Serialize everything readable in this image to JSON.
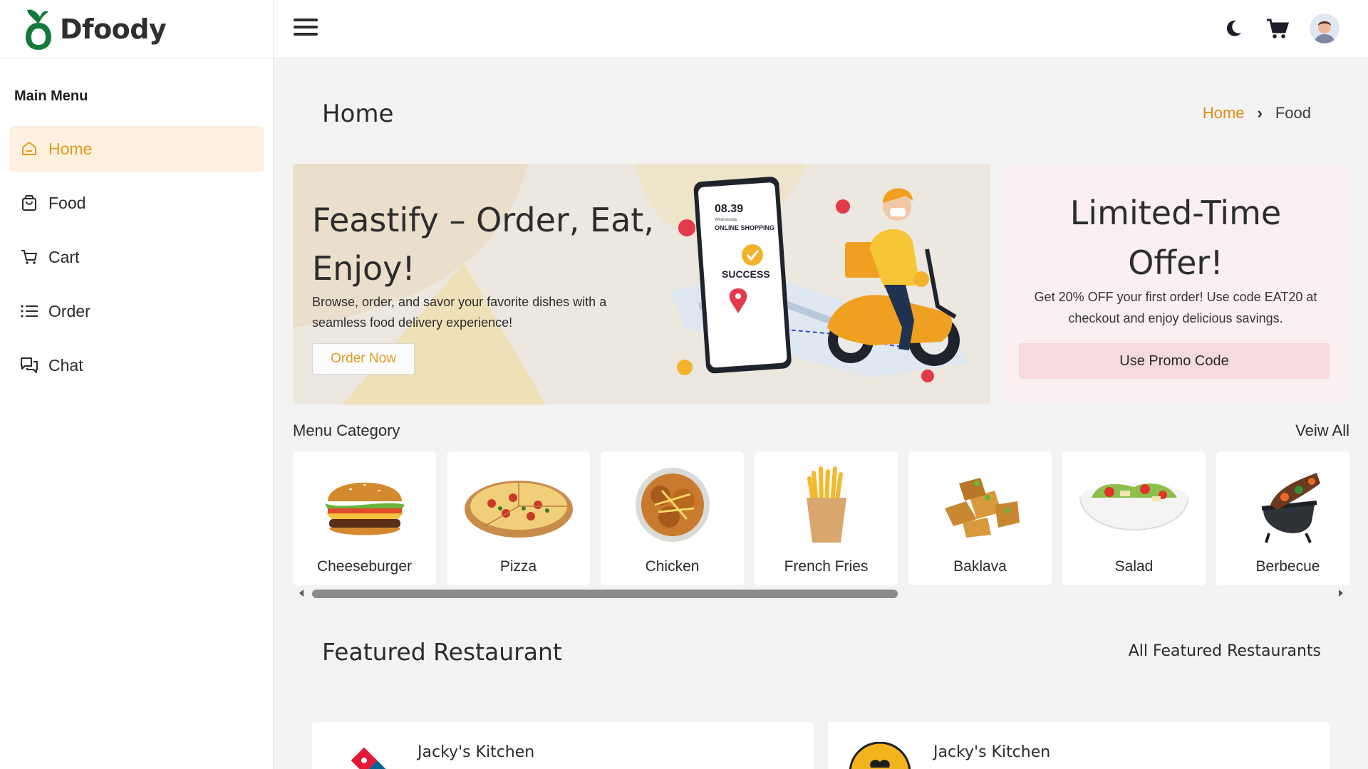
{
  "brand": {
    "name": "Dfoody",
    "accent": "#e29b21",
    "logo_color": "#137a3c"
  },
  "header": {
    "menu_icon": "hamburger-icon",
    "actions": [
      {
        "icon": "moon-icon"
      },
      {
        "icon": "cart-icon"
      },
      {
        "icon": "user-avatar"
      }
    ]
  },
  "sidebar": {
    "heading": "Main Menu",
    "items": [
      {
        "label": "Home",
        "icon": "home-icon",
        "active": true
      },
      {
        "label": "Food",
        "icon": "shopping-bag-icon",
        "active": false
      },
      {
        "label": "Cart",
        "icon": "cart-icon",
        "active": false
      },
      {
        "label": "Order",
        "icon": "list-icon",
        "active": false
      },
      {
        "label": "Chat",
        "icon": "chat-icon",
        "active": false
      }
    ]
  },
  "page": {
    "title": "Home",
    "breadcrumb": {
      "home": "Home",
      "separator": "›",
      "current": "Food"
    }
  },
  "hero": {
    "title": "Feastify – Order, Eat, Enjoy!",
    "text": "Browse, order, and savor your favorite dishes with a seamless food delivery experience!",
    "button": "Order Now",
    "phone_time": "08.39",
    "phone_day": "Wednesday",
    "phone_caption": "ONLINE SHOPPING",
    "phone_status": "SUCCESS"
  },
  "offer": {
    "title": "Limited-Time Offer!",
    "text": "Get 20% OFF your first order! Use code EAT20 at checkout and enjoy delicious savings.",
    "button": "Use Promo Code"
  },
  "categories": {
    "heading": "Menu Category",
    "view_all": "Veiw All",
    "items": [
      {
        "label": "Cheeseburger",
        "icon": "burger-icon"
      },
      {
        "label": "Pizza",
        "icon": "pizza-icon"
      },
      {
        "label": "Chicken",
        "icon": "chicken-icon"
      },
      {
        "label": "French Fries",
        "icon": "fries-icon"
      },
      {
        "label": "Baklava",
        "icon": "baklava-icon"
      },
      {
        "label": "Salad",
        "icon": "salad-icon"
      },
      {
        "label": "Berbecue",
        "icon": "barbecue-icon"
      }
    ]
  },
  "featured": {
    "heading": "Featured Restaurant",
    "view_all": "All Featured Restaurants",
    "restaurants": [
      {
        "name": "Jacky's Kitchen",
        "logo": "domino-logo"
      },
      {
        "name": "Jacky's Kitchen",
        "logo": "chef-logo"
      }
    ]
  }
}
